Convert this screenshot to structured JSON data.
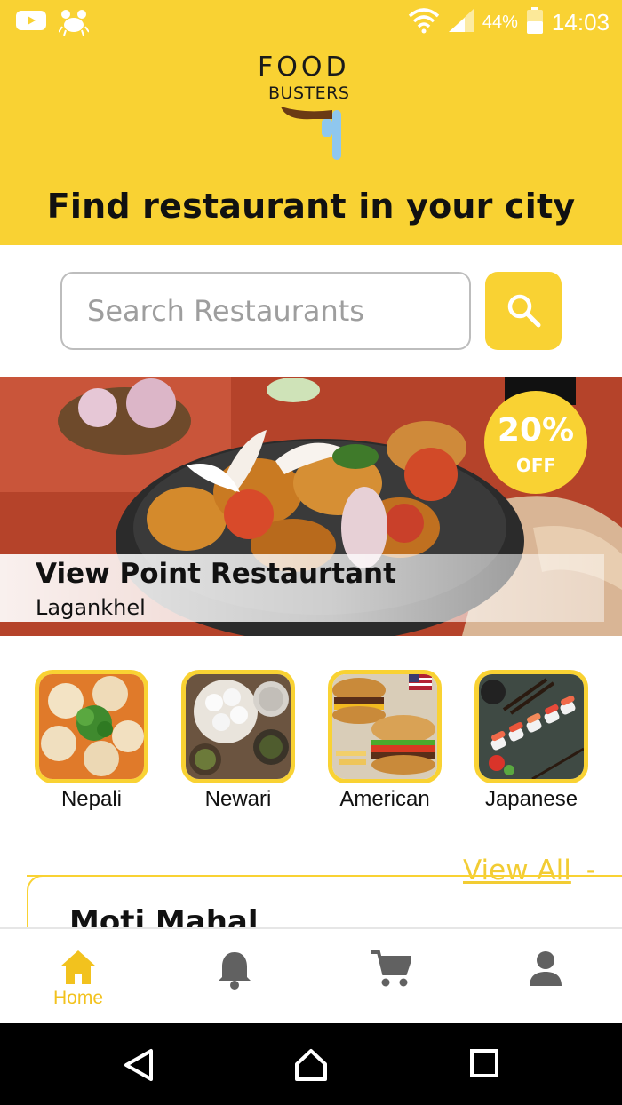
{
  "status_bar": {
    "battery_percent": "44%",
    "time": "14:03",
    "icons": [
      "youtube-icon",
      "crab-icon",
      "wifi-icon",
      "signal-icon",
      "battery-icon"
    ]
  },
  "header": {
    "logo_line1": "FOOD",
    "logo_line2": "BUSTERS",
    "tagline": "Find restaurant in your city",
    "background_color": "#f9d233"
  },
  "search": {
    "placeholder": "Search Restaurants",
    "value": "",
    "button_icon": "search-icon"
  },
  "featured": {
    "title": "View Point Restaurtant",
    "location": "Lagankhel",
    "discount_value": "20%",
    "discount_label": "OFF"
  },
  "categories": [
    {
      "label": "Nepali"
    },
    {
      "label": "Newari"
    },
    {
      "label": "American"
    },
    {
      "label": "Japanese"
    }
  ],
  "section": {
    "view_all": "View All",
    "dash": "-",
    "first_card_title": "Moti Mahal"
  },
  "bottom_nav": {
    "items": [
      {
        "label": "Home",
        "icon": "home-icon",
        "active": true
      },
      {
        "label": "",
        "icon": "bell-icon",
        "active": false
      },
      {
        "label": "",
        "icon": "cart-icon",
        "active": false
      },
      {
        "label": "",
        "icon": "person-icon",
        "active": false
      }
    ],
    "active_color": "#f2c21e",
    "inactive_color": "#616161"
  },
  "android_nav": {
    "icons": [
      "back-icon",
      "home-nav-icon",
      "recents-icon"
    ]
  }
}
